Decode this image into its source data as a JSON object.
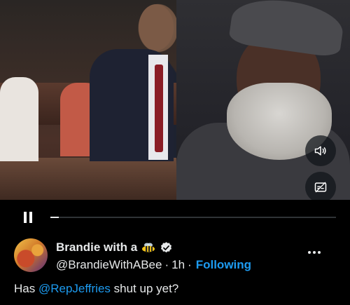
{
  "video": {
    "progress_fraction": 0.03
  },
  "author": {
    "display_name": "Brandie with a",
    "handle": "@BrandieWithABee",
    "time": "1h",
    "separator": "·",
    "follow_label": "Following"
  },
  "tweet": {
    "text_before": "Has ",
    "mention": "@RepJeffries",
    "text_after": " shut up yet?"
  },
  "icons": {
    "volume": "volume-icon",
    "caption": "captions-off-icon",
    "pause": "pause-icon",
    "verified": "verified-badge-icon",
    "bee": "bee-emoji-icon",
    "more": "more-icon"
  },
  "colors": {
    "accent": "#1d9bf0",
    "text": "#e7e9ea",
    "background": "#000000"
  }
}
